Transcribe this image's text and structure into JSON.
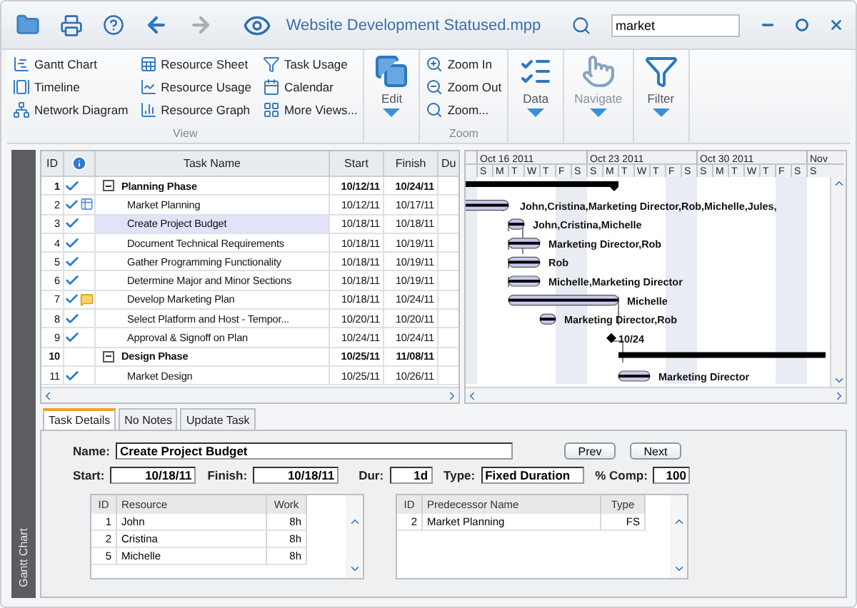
{
  "window": {
    "title": "Website Development Statused.mpp",
    "forward_disabled": true
  },
  "search": {
    "value": "market"
  },
  "ribbon": {
    "view_items": [
      "Gantt Chart",
      "Timeline",
      "Network Diagram",
      "Resource Sheet",
      "Resource Usage",
      "Resource Graph",
      "Task Usage",
      "Calendar",
      "More Views..."
    ],
    "view_label": "View",
    "zoom_items": [
      "Zoom In",
      "Zoom Out",
      "Zoom..."
    ],
    "zoom_label": "Zoom",
    "big_buttons": [
      {
        "label": "Edit",
        "disabled": false
      },
      {
        "label": "Data",
        "disabled": false
      },
      {
        "label": "Navigate",
        "disabled": true
      },
      {
        "label": "Filter",
        "disabled": false
      }
    ]
  },
  "side_tab": "Gantt Chart",
  "table": {
    "columns": [
      "ID",
      "Task Name",
      "Start",
      "Finish",
      "Du"
    ],
    "rows": [
      {
        "id": "1",
        "complete": true,
        "kind": "plain",
        "summary": true,
        "expanded": true,
        "selected": false,
        "name": "Planning Phase",
        "start": "10/12/11",
        "finish": "10/24/11"
      },
      {
        "id": "2",
        "complete": true,
        "kind": "with-table",
        "summary": false,
        "selected": false,
        "name": "Market Planning",
        "start": "10/12/11",
        "finish": "10/17/11",
        "gantt_label": "John,Cristina,Marketing Director,Rob,Michelle,Jules,"
      },
      {
        "id": "3",
        "complete": true,
        "kind": "plain",
        "summary": false,
        "selected": true,
        "name": "Create Project Budget",
        "start": "10/18/11",
        "finish": "10/18/11",
        "gantt_label": "John,Cristina,Michelle"
      },
      {
        "id": "4",
        "complete": true,
        "kind": "plain",
        "summary": false,
        "selected": false,
        "name": "Document Technical Requirements",
        "start": "10/18/11",
        "finish": "10/19/11",
        "gantt_label": "Marketing Director,Rob"
      },
      {
        "id": "5",
        "complete": true,
        "kind": "plain",
        "summary": false,
        "selected": false,
        "name": "Gather Programming Functionality",
        "start": "10/18/11",
        "finish": "10/19/11",
        "gantt_label": "Rob"
      },
      {
        "id": "6",
        "complete": true,
        "kind": "plain",
        "summary": false,
        "selected": false,
        "name": "Determine Major and Minor Sections",
        "start": "10/18/11",
        "finish": "10/19/11",
        "gantt_label": "Michelle,Marketing Director"
      },
      {
        "id": "7",
        "complete": true,
        "kind": "with-note",
        "summary": false,
        "selected": false,
        "name": "Develop Marketing Plan",
        "start": "10/18/11",
        "finish": "10/24/11",
        "gantt_label": "Michelle"
      },
      {
        "id": "8",
        "complete": true,
        "kind": "plain",
        "summary": false,
        "selected": false,
        "name": "Select Platform and Host - Tempor...",
        "start": "10/20/11",
        "finish": "10/20/11",
        "gantt_label": "Marketing Director,Rob"
      },
      {
        "id": "9",
        "complete": true,
        "kind": "plain",
        "summary": false,
        "selected": false,
        "name": "Approval & Signoff on Plan",
        "start": "10/24/11",
        "finish": "10/24/11",
        "gantt_label": "10/24"
      },
      {
        "id": "10",
        "complete": false,
        "kind": "plain",
        "summary": true,
        "expanded": true,
        "selected": false,
        "name": "Design Phase",
        "start": "10/25/11",
        "finish": "11/08/11"
      },
      {
        "id": "11",
        "complete": true,
        "kind": "plain",
        "summary": false,
        "selected": false,
        "name": "Market Design",
        "start": "10/25/11",
        "finish": "10/26/11",
        "gantt_label": "Marketing Director"
      }
    ]
  },
  "gantt": {
    "weeks": [
      "Oct 16 2011",
      "Oct 23 2011",
      "Oct 30 2011",
      "Nov"
    ],
    "days": [
      "S",
      "M",
      "T",
      "W",
      "T",
      "F",
      "S",
      "S",
      "M",
      "T",
      "W",
      "T",
      "F",
      "S",
      "S",
      "M",
      "T",
      "W",
      "T",
      "F",
      "S",
      "S"
    ]
  },
  "detail_tabs": [
    {
      "label": "Task Details",
      "selected": true
    },
    {
      "label": "No Notes",
      "selected": false
    },
    {
      "label": "Update Task",
      "selected": false
    }
  ],
  "details": {
    "name_label": "Name:",
    "name": "Create Project Budget",
    "prev": "Prev",
    "next": "Next",
    "start_label": "Start:",
    "start": "10/18/11",
    "finish_label": "Finish:",
    "finish": "10/18/11",
    "dur_label": "Dur:",
    "dur": "1d",
    "type_label": "Type:",
    "type": "Fixed Duration",
    "comp_label": "% Comp:",
    "comp": "100"
  },
  "resources": {
    "columns": [
      "ID",
      "Resource",
      "Work"
    ],
    "rows": [
      {
        "id": "1",
        "name": "John",
        "work": "8h"
      },
      {
        "id": "2",
        "name": "Cristina",
        "work": "8h"
      },
      {
        "id": "5",
        "name": "Michelle",
        "work": "8h"
      }
    ]
  },
  "predecessors": {
    "columns": [
      "ID",
      "Predecessor Name",
      "Type"
    ],
    "rows": [
      {
        "id": "2",
        "name": "Market Planning",
        "type": "FS"
      }
    ]
  }
}
